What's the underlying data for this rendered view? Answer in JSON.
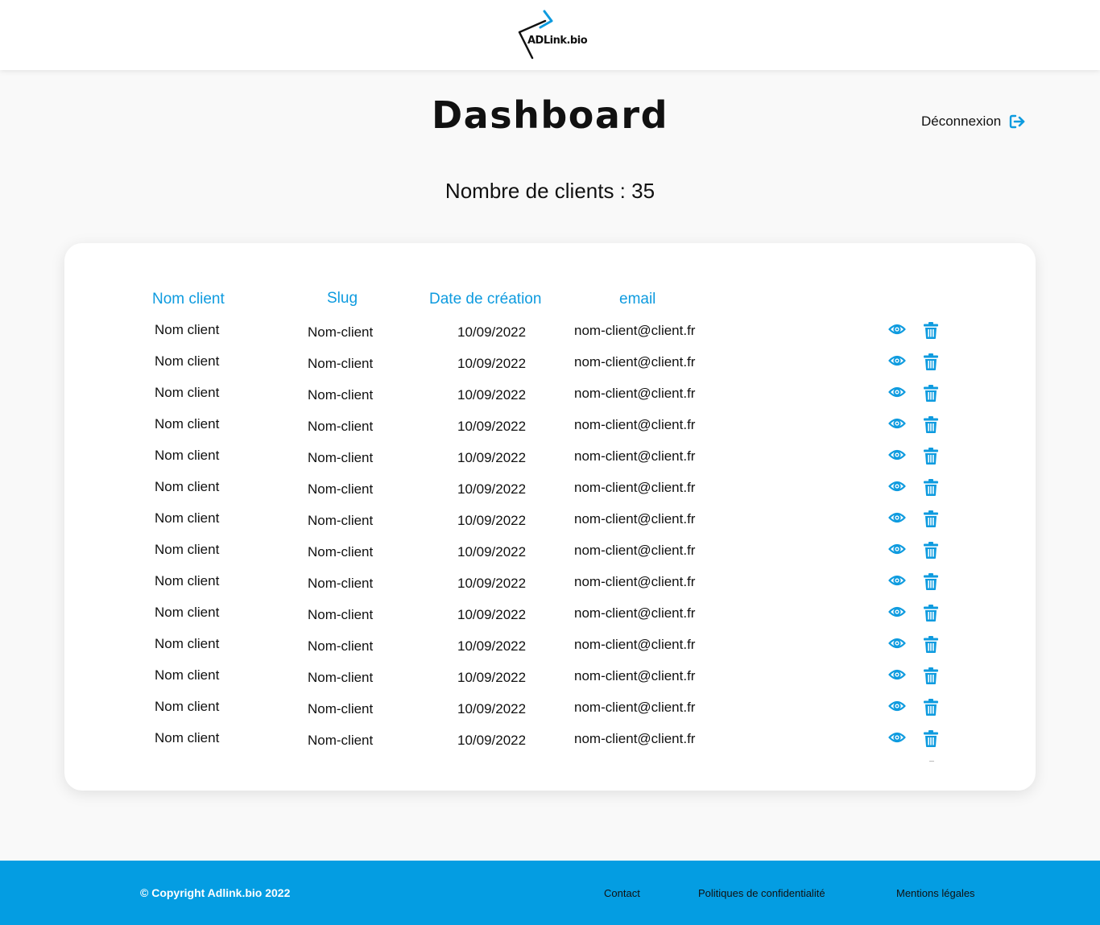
{
  "header": {
    "logo_text": "ADLink.bio"
  },
  "page": {
    "title": "Dashboard",
    "logout_label": "Déconnexion",
    "client_count_text": "Nombre de clients : 35"
  },
  "table": {
    "headers": {
      "name": "Nom client",
      "slug": "Slug",
      "date": "Date de création",
      "email": "email"
    },
    "rows": [
      {
        "name": "Nom client",
        "slug": "Nom-client",
        "date": "10/09/2022",
        "email": "nom-client@client.fr"
      },
      {
        "name": "Nom client",
        "slug": "Nom-client",
        "date": "10/09/2022",
        "email": "nom-client@client.fr"
      },
      {
        "name": "Nom client",
        "slug": "Nom-client",
        "date": "10/09/2022",
        "email": "nom-client@client.fr"
      },
      {
        "name": "Nom client",
        "slug": "Nom-client",
        "date": "10/09/2022",
        "email": "nom-client@client.fr"
      },
      {
        "name": "Nom client",
        "slug": "Nom-client",
        "date": "10/09/2022",
        "email": "nom-client@client.fr"
      },
      {
        "name": "Nom client",
        "slug": "Nom-client",
        "date": "10/09/2022",
        "email": "nom-client@client.fr"
      },
      {
        "name": "Nom client",
        "slug": "Nom-client",
        "date": "10/09/2022",
        "email": "nom-client@client.fr"
      },
      {
        "name": "Nom client",
        "slug": "Nom-client",
        "date": "10/09/2022",
        "email": "nom-client@client.fr"
      },
      {
        "name": "Nom client",
        "slug": "Nom-client",
        "date": "10/09/2022",
        "email": "nom-client@client.fr"
      },
      {
        "name": "Nom client",
        "slug": "Nom-client",
        "date": "10/09/2022",
        "email": "nom-client@client.fr"
      },
      {
        "name": "Nom client",
        "slug": "Nom-client",
        "date": "10/09/2022",
        "email": "nom-client@client.fr"
      },
      {
        "name": "Nom client",
        "slug": "Nom-client",
        "date": "10/09/2022",
        "email": "nom-client@client.fr"
      },
      {
        "name": "Nom client",
        "slug": "Nom-client",
        "date": "10/09/2022",
        "email": "nom-client@client.fr"
      },
      {
        "name": "Nom client",
        "slug": "Nom-client",
        "date": "10/09/2022",
        "email": "nom-client@client.fr"
      }
    ],
    "row_actions": [
      "eye-icon",
      "trash-icon"
    ]
  },
  "footer": {
    "copyright": "© Copyright Adlink.bio 2022",
    "links": [
      "Contact",
      "Politiques de confidentialité",
      "Mentions légales"
    ]
  },
  "colors": {
    "accent": "#0e9bdf",
    "footer_bg": "#049de2",
    "page_bg": "#f9f9f9"
  }
}
